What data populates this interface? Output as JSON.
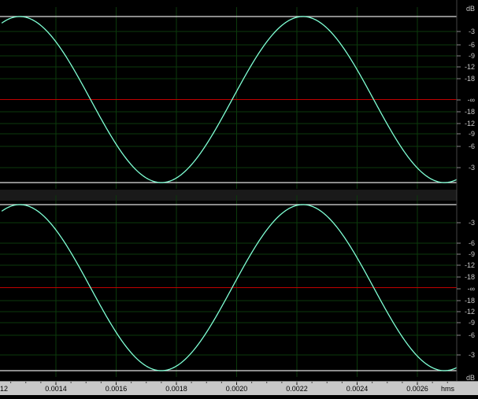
{
  "waveform_view": {
    "db_scale": {
      "unit": "dB",
      "neg_inf": "-∞",
      "ticks_ch1": [
        "-3",
        "-6",
        "-9",
        "-12",
        "-18",
        "-∞",
        "-18",
        "-12",
        "-9",
        "-6",
        "-3"
      ],
      "ticks_ch2": [
        "-3",
        "-6",
        "-9",
        "-12",
        "-18",
        "-∞",
        "-18",
        "-12",
        "-9",
        "-6",
        "-3"
      ]
    },
    "time_ruler": {
      "unit": "hms",
      "partial_left_label": "12",
      "labels": [
        "0.0014",
        "0.0016",
        "0.0018",
        "0.0020",
        "0.0022",
        "0.0024",
        "0.0026"
      ]
    },
    "colors": {
      "background": "#000000",
      "waveform": "#7fffd4",
      "center_line": "#c00000",
      "grid": "#0c3a0c",
      "clip_line": "#e0e0e0",
      "ruler_bg": "#c8c8c8"
    },
    "signal": {
      "shape": "sine",
      "peak_times_s": [
        0.00128,
        0.00222
      ],
      "trough_times_s": [
        0.00172,
        0.0027
      ],
      "period_s": 0.00094
    }
  }
}
